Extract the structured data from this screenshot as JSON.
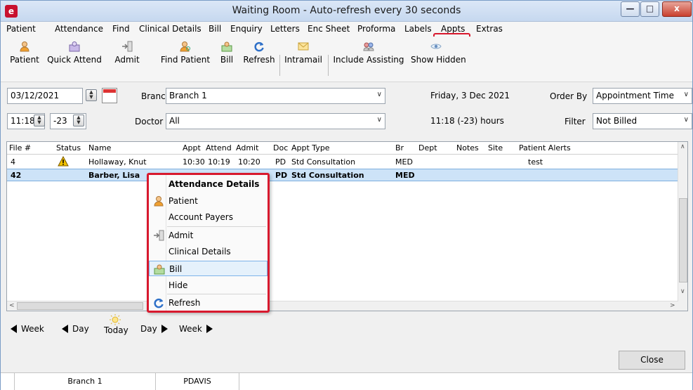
{
  "window": {
    "title": "Waiting Room - Auto-refresh every 30 seconds",
    "min_glyph": "—",
    "max_glyph": "□",
    "close_glyph": "x"
  },
  "menu": [
    "Patient",
    "Attendance",
    "Find",
    "Clinical Details",
    "Bill",
    "Enquiry",
    "Letters",
    "Enc Sheet",
    "Proforma",
    "Labels",
    "Appts",
    "Extras"
  ],
  "toolbar": {
    "patient": "Patient",
    "quick_attend": "Quick Attend",
    "admit": "Admit",
    "find_patient": "Find Patient",
    "bill": "Bill",
    "refresh": "Refresh",
    "intramail": "Intramail",
    "include_assisting": "Include Assisting",
    "show_hidden": "Show Hidden"
  },
  "filters": {
    "date": "03/12/2021",
    "branch_label": "Branch",
    "branch_value": "Branch 1",
    "date_long": "Friday, 3 Dec 2021",
    "order_by_label": "Order By",
    "order_by_value": "Appointment Time",
    "time": "11:18",
    "offset": "-23",
    "doctor_label": "Doctor",
    "doctor_value": "All",
    "time_status": "11:18 (-23)  hours",
    "filter_label": "Filter",
    "filter_value": "Not Billed"
  },
  "table": {
    "columns": [
      "File #",
      "Status",
      "Name",
      "Appt",
      "Attend",
      "Admit",
      "Doc",
      "Appt Type",
      "Br",
      "Dept",
      "Notes",
      "Site",
      "Patient Alerts"
    ],
    "rows": [
      {
        "file": "4",
        "status": "warning",
        "name": "Hollaway, Knut",
        "appt": "10:30",
        "attend": "10:19",
        "admit": "10:20",
        "doc": "PD",
        "type": "Std Consultation",
        "br": "MED",
        "dept": "",
        "notes": "",
        "site": "",
        "alerts": "test"
      },
      {
        "file": "42",
        "status": "",
        "name": "Barber, Lisa",
        "appt": "",
        "attend": "",
        "admit": "",
        "doc": "PD",
        "type": "Std Consultation",
        "br": "MED",
        "dept": "",
        "notes": "",
        "site": "",
        "alerts": ""
      }
    ]
  },
  "context_menu": {
    "header": "Attendance Details",
    "patient": "Patient",
    "account_payers": "Account Payers",
    "admit": "Admit",
    "clinical_details": "Clinical Details",
    "bill": "Bill",
    "hide": "Hide",
    "refresh": "Refresh"
  },
  "nav": {
    "week_back": "Week",
    "day_back": "Day",
    "today": "Today",
    "day_fwd": "Day",
    "week_fwd": "Week"
  },
  "close_button": "Close",
  "status_bar": {
    "branch": "Branch 1",
    "user": "PDAVIS"
  },
  "colors": {
    "highlight_border": "#d8192e",
    "selected_row": "#cde3f8",
    "warning": "#f2c200"
  }
}
